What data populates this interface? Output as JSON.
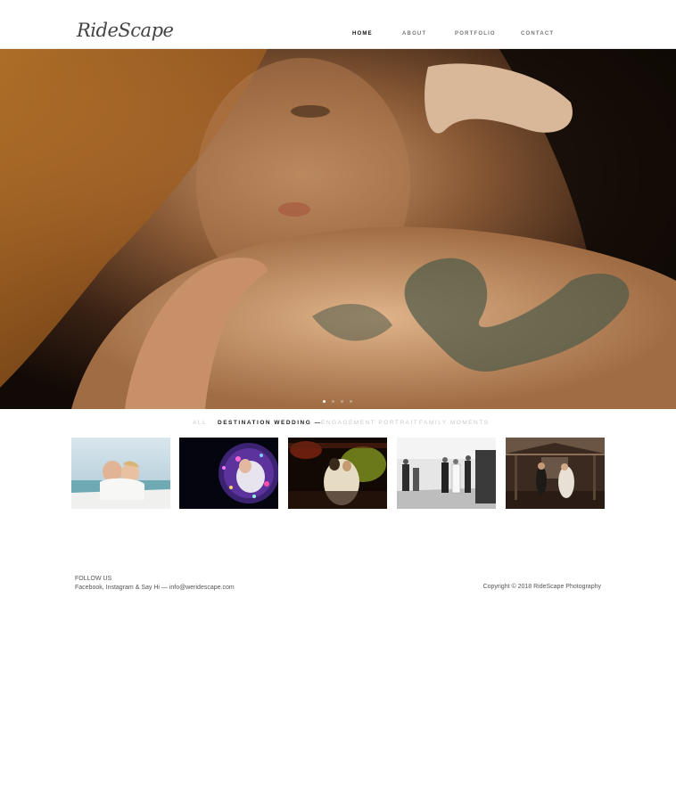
{
  "brand": {
    "logo_text": "RideScape"
  },
  "nav": {
    "items": [
      {
        "label": "HOME",
        "active": true
      },
      {
        "label": "ABOUT",
        "active": false
      },
      {
        "label": "PORTFOLIO",
        "active": false
      },
      {
        "label": "CONTACT",
        "active": false
      }
    ]
  },
  "hero": {
    "slide_count": 4,
    "active_slide": 1
  },
  "filters": {
    "items": [
      {
        "label": "ALL",
        "active": false
      },
      {
        "label": "DESTINATION WEDDING —",
        "active": true
      },
      {
        "label": "ENGAGEMENT PORTRAIT",
        "active": false
      },
      {
        "label": "FAMILY MOMENTS",
        "active": false
      }
    ]
  },
  "gallery": {
    "items": [
      {
        "name": "couple-boat-photo"
      },
      {
        "name": "bride-lights-photo"
      },
      {
        "name": "first-dance-photo"
      },
      {
        "name": "ceremony-aisle-photo"
      },
      {
        "name": "barn-couple-photo"
      }
    ]
  },
  "footer": {
    "follow_label": "FOLLOW US",
    "social_text": "Facebook, Instagram & Say Hi — info@weridescape.com",
    "copyright": "Copyright © 2018 RideScape Photography"
  }
}
